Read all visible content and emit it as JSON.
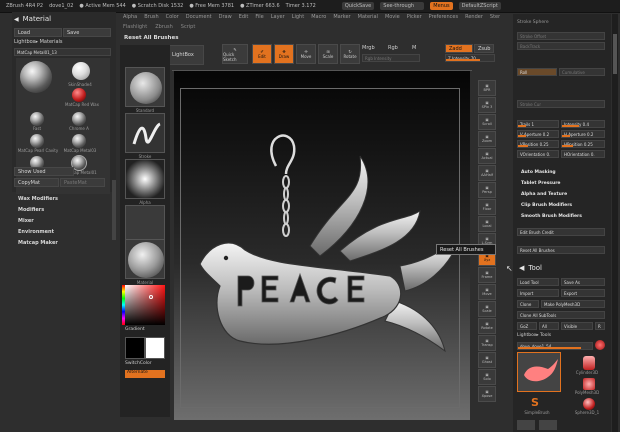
{
  "titlebar": {
    "app": "ZBrush 4R4 P2",
    "doc": "dove1_02",
    "active_mem": "● Active Mem 544",
    "scratch": "● Scratch Disk 1532",
    "free_mem": "● Free Mem 3781",
    "timer": "● ZTimer 663.6",
    "poly": "Timer 3.172",
    "quicksave": "QuickSave",
    "see_through": "See-through",
    "see_through_val": "0",
    "menus": "Menus",
    "script": "DefaultZScript"
  },
  "menubar": [
    "Alpha",
    "Brush",
    "Color",
    "Document",
    "Draw",
    "Edit",
    "File",
    "Layer",
    "Light",
    "Macro",
    "Marker",
    "Material",
    "Movie",
    "Picker",
    "Preferences",
    "Render",
    "Stencil",
    "Stroke",
    "Texture",
    "Tool"
  ],
  "submenubar": [
    "Flashlight",
    "Zbrush",
    "Script"
  ],
  "colors": {
    "accent": "#e2721f",
    "bg": "#2e2e2e",
    "canvas_top": "#050505",
    "canvas_bottom": "#6e6e6e"
  },
  "left_panel": {
    "title": "Material",
    "load": "Load",
    "save": "Save",
    "lightbox": "Lightbox▸ Materials",
    "matcap": "MatCap Metal01_13",
    "materials": [
      "SkinShade4",
      "Toy Plastic",
      "MatCap Red Wax",
      "Fast",
      "Chrome A",
      "MatCap Pearl Cavity",
      "MatCap Metal03",
      "JellyBean",
      "MatCap Metal01"
    ],
    "show_used": "Show Used",
    "copymat": "CopyMat",
    "pastemat": "PasteMat",
    "groups": [
      "Wax Modifiers",
      "Modifiers",
      "Mixer",
      "Environment",
      "Matcap Maker"
    ]
  },
  "top_tools": {
    "projection_master": "Projection Master",
    "lightbox": "LightBox",
    "quick_sketch": "Quick Sketch",
    "edit": "Edit",
    "draw": "Draw",
    "move": "Move",
    "scale": "Scale",
    "rotate": "Rotate",
    "mrgb": "Mrgb",
    "rgb": "Rgb",
    "m": "M",
    "zadd": "Zadd",
    "zsub": "Zsub",
    "z_intensity": "Z Intensity 70",
    "rgb_intensity": "Rgb Intensity",
    "reset_all_brushes": "Reset All Brushes",
    "clip_all": "Cl.All"
  },
  "left_shelf": {
    "gradient": "Gradient",
    "switchcolor": "SwitchColor",
    "alternate": "Alternate",
    "slot_labels": [
      "Standard",
      "Stroke",
      "Alpha",
      "Texture",
      "Material"
    ]
  },
  "right_shelf": [
    "BPR",
    "SPix 3",
    "Scroll",
    "Zoom",
    "Actual",
    "AAHalf",
    "Persp",
    "Floor",
    "Local",
    "L.Sym",
    "Xyz",
    "Frame",
    "Move",
    "Scale",
    "Rotate",
    "Transp",
    "Ghost",
    "Solo",
    "Xpose"
  ],
  "tooltip": "Reset All Brushes",
  "right_panel": {
    "top_items": [
      "Stroke Sphere",
      "Stroke Offset",
      "BackTrack",
      "Roll",
      "Cumulative",
      "Stroke Cur"
    ],
    "trails": "Trails 1",
    "intensity": "Intensity 0.4",
    "v_aperture": "V Aperture 0.2",
    "h_aperture": "H Aperture 0.2",
    "v_position": "VPosition 0.25",
    "h_position": "HPosition 0.25",
    "v_orientation": "VOrientation 0.",
    "h_orientation": "HOrientation 0.",
    "auto_masking": "Auto Masking",
    "tablet_pressure": "Tablet Pressure",
    "alpha_texture": "Alpha and Texture",
    "clip_brush": "Clip Brush Modifiers",
    "smooth_brush": "Smooth Brush Modifiers",
    "edit_brush_credit": "Edit Brush Credit",
    "reset_all_brushes": "Reset All Brushes",
    "tool_title": "Tool",
    "load_tool": "Load Tool",
    "save_as": "Save As",
    "import": "Import",
    "export": "Export",
    "clone": "Clone",
    "make_polymesh": "Make PolyMesh3D",
    "goz": "GoZ",
    "all": "All",
    "visible": "Visible",
    "r": "R",
    "lightbox_tools": "Lightbox▸ Tools",
    "current_tool": "dove_dove1_54",
    "clone_subtools": "Clone All SubTools",
    "tools": [
      "Cylinder3D",
      "PolyMesh3D",
      "SimpleBrush",
      "Sphere3D_1"
    ]
  }
}
